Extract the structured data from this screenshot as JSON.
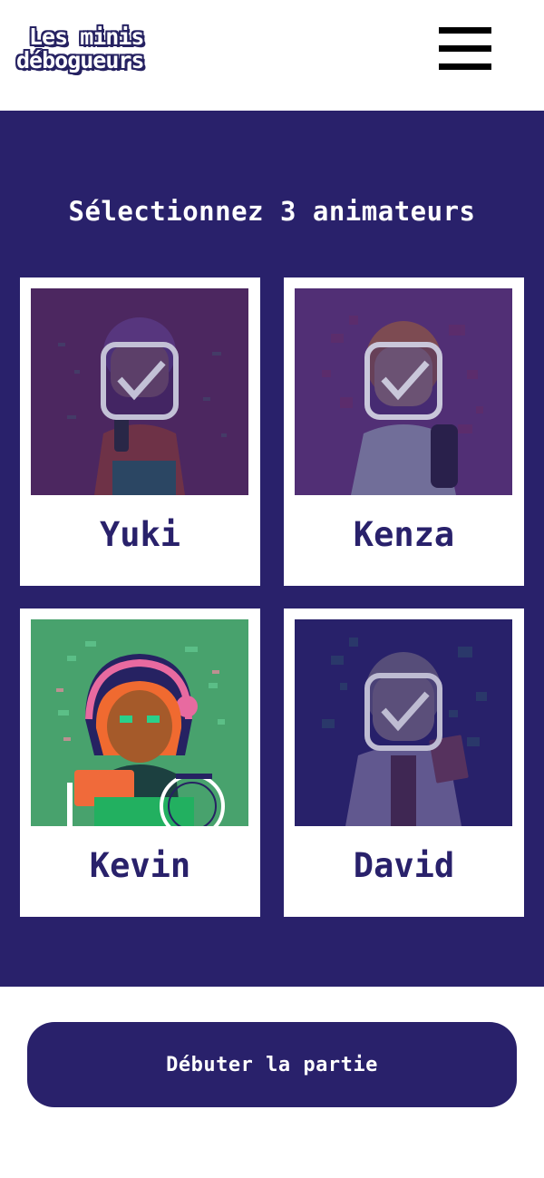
{
  "brand": {
    "line1": "Les minis",
    "line2": "débogueurs"
  },
  "main": {
    "heading": "Sélectionnez 3 animateurs",
    "cards": [
      {
        "name": "Yuki",
        "selected": true,
        "background": "#5b2a5c"
      },
      {
        "name": "Kenza",
        "selected": true,
        "background": "#5f3479"
      },
      {
        "name": "Kevin",
        "selected": false,
        "background": "#48a26d"
      },
      {
        "name": "David",
        "selected": true,
        "background": "#29216b"
      }
    ]
  },
  "footer": {
    "start_label": "Débuter la partie"
  },
  "colors": {
    "primary": "#29216b",
    "surface": "#ffffff",
    "kevin_bg": "#48a26d"
  }
}
